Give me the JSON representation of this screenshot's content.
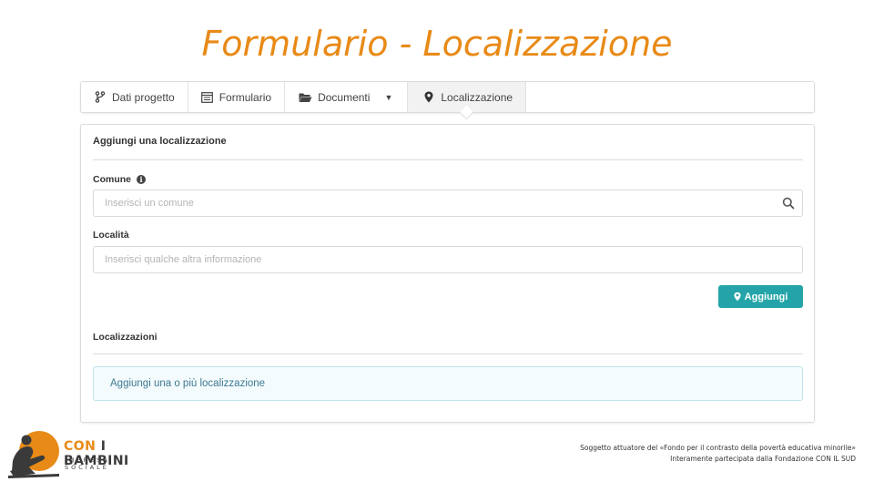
{
  "slide": {
    "title": "Formulario - Localizzazione"
  },
  "tabs": [
    {
      "label": "Dati progetto",
      "icon": "branch-icon"
    },
    {
      "label": "Formulario",
      "icon": "form-icon"
    },
    {
      "label": "Documenti",
      "icon": "folder-open-icon",
      "has_dropdown": true
    },
    {
      "label": "Localizzazione",
      "icon": "map-marker-icon",
      "active": true
    }
  ],
  "panel": {
    "heading": "Aggiungi una localizzazione",
    "comune": {
      "label": "Comune",
      "placeholder": "Inserisci un comune",
      "value": ""
    },
    "localita": {
      "label": "Località",
      "placeholder": "Inserisci qualche altra informazione",
      "value": ""
    },
    "add_button_label": "Aggiungi",
    "list_heading": "Localizzazioni",
    "empty_message": "Aggiungi una o più localizzazione"
  },
  "footer": {
    "logo_text_con": "CON",
    "logo_text_rest": " I BAMBINI",
    "logo_subtitle": "IMPRESA SOCIALE",
    "line1": "Soggetto attuatore del «Fondo per il contrasto della povertà educativa minorile»",
    "line2": "Interamente partecipata dalla Fondazione CON IL SUD"
  },
  "colors": {
    "title": "#e88a17",
    "accent_button": "#24a4a8",
    "alert_background": "#f3fbfd",
    "alert_text": "#3e7a92"
  }
}
